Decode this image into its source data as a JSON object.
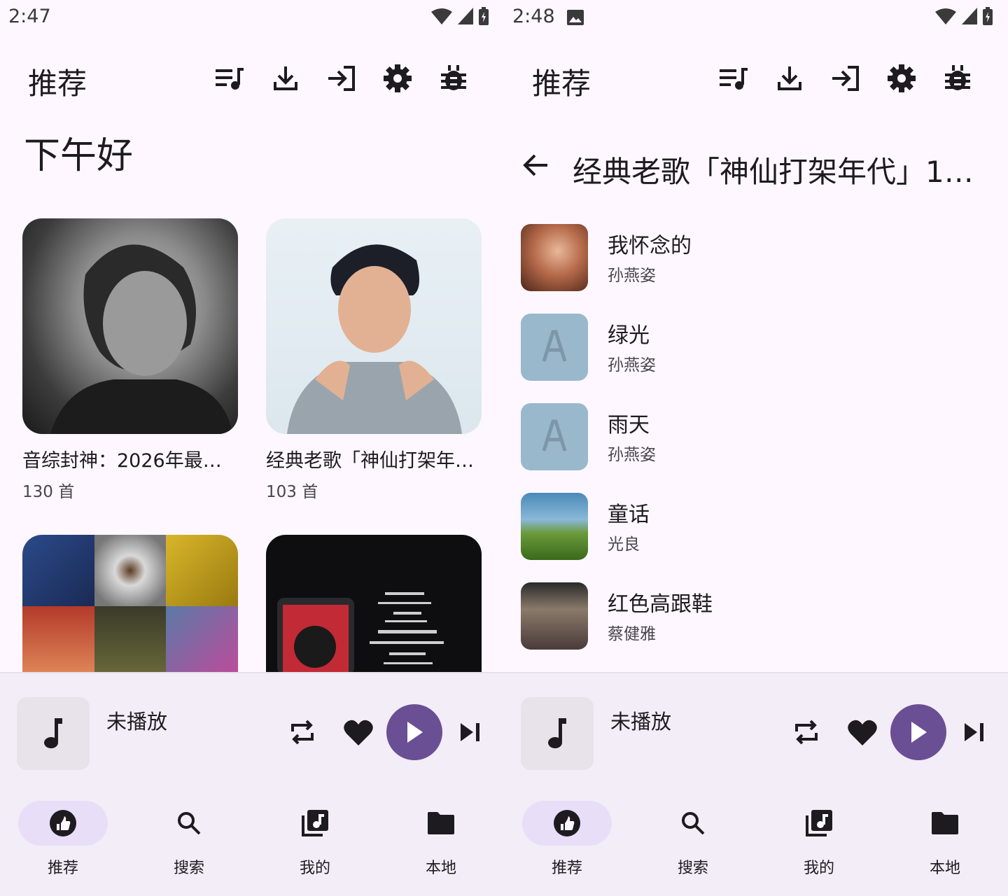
{
  "left": {
    "status": {
      "time": "2:47"
    },
    "app_bar": {
      "title": "推荐"
    },
    "greeting": "下午好",
    "cards": [
      {
        "title": "音综封神：2026年最…",
        "subtitle": "130 首"
      },
      {
        "title": "经典老歌「神仙打架年…",
        "subtitle": "103 首"
      }
    ],
    "mini_player": {
      "title": "未播放"
    },
    "nav": {
      "items": [
        {
          "label": "推荐"
        },
        {
          "label": "搜索"
        },
        {
          "label": "我的"
        },
        {
          "label": "本地"
        }
      ]
    }
  },
  "right": {
    "status": {
      "time": "2:48"
    },
    "app_bar": {
      "title": "推荐"
    },
    "playlist_title": "经典老歌「神仙打架年代」1…",
    "tracks": [
      {
        "title": "我怀念的",
        "artist": "孙燕姿"
      },
      {
        "title": "绿光",
        "artist": "孙燕姿"
      },
      {
        "title": "雨天",
        "artist": "孙燕姿"
      },
      {
        "title": "童话",
        "artist": "光良"
      },
      {
        "title": "红色高跟鞋",
        "artist": "蔡健雅"
      }
    ],
    "mini_player": {
      "title": "未播放"
    },
    "nav": {
      "items": [
        {
          "label": "推荐"
        },
        {
          "label": "搜索"
        },
        {
          "label": "我的"
        },
        {
          "label": "本地"
        }
      ]
    }
  },
  "icons": {
    "app_actions": [
      "queue-music-icon",
      "download-icon",
      "login-icon",
      "settings-icon",
      "bug-icon"
    ],
    "nav": [
      "recommend-icon",
      "search-icon",
      "library-music-icon",
      "folder-icon"
    ]
  },
  "colors": {
    "background": "#fef7ff",
    "surface": "#f3edf7",
    "accent": "#6b4f95",
    "nav_active": "#e8def8"
  }
}
